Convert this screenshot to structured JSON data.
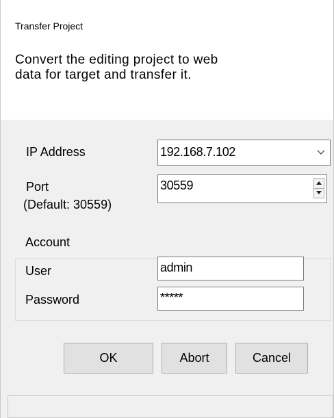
{
  "window": {
    "title": "Transfer Project",
    "description": "Convert the editing project to web\ndata for target and transfer it."
  },
  "form": {
    "ip_label": "IP Address",
    "ip_value": "192.168.7.102",
    "port_label": "Port",
    "port_default_note": "(Default: 30559)",
    "port_value": "30559"
  },
  "account": {
    "group_label": "Account",
    "user_label": "User",
    "user_value": "admin",
    "password_label": "Password",
    "password_value": "*****"
  },
  "buttons": {
    "ok": "OK",
    "abort": "Abort",
    "cancel": "Cancel"
  },
  "icons": {
    "combo": "chevron-down-icon",
    "spin_up": "spin-up-icon",
    "spin_down": "spin-down-icon"
  }
}
